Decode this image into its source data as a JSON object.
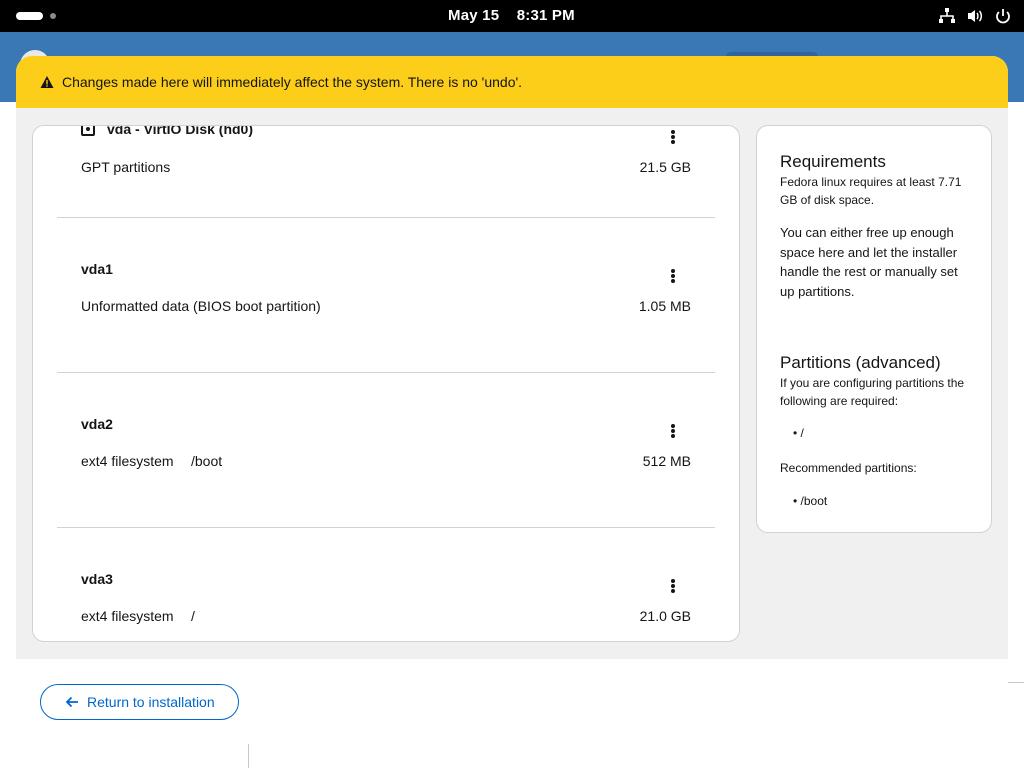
{
  "topbar": {
    "date": "May 15",
    "time": "8:31 PM",
    "icons": [
      "network-icon",
      "volume-icon",
      "power-icon"
    ]
  },
  "warning": {
    "text": "Changes made here will immediately affect the system. There is no 'undo'.",
    "icon": "warning-icon",
    "color": "#fcce1a"
  },
  "disk": {
    "title": "vda -  VirtIO Disk (hd0)",
    "type": "GPT partitions",
    "size": "21.5 GB",
    "partitions": [
      {
        "name": "vda1",
        "type": "Unformatted data (BIOS boot partition)",
        "mount": "",
        "size": "1.05 MB"
      },
      {
        "name": "vda2",
        "type": "ext4 filesystem",
        "mount": "/boot",
        "size": "512 MB"
      },
      {
        "name": "vda3",
        "type": "ext4 filesystem",
        "mount": "/",
        "size": "21.0 GB"
      }
    ]
  },
  "sidebar": {
    "requirements_title": "Requirements",
    "requirements_text": "Fedora linux requires at least 7.71 GB of disk space.",
    "requirements_hint": "You can either free up enough space here and let the installer handle the rest or manually set up partitions.",
    "advanced_title": "Partitions (advanced)",
    "advanced_text": "If you are configuring partitions the following are required:",
    "required": [
      "/"
    ],
    "recommended_label": "Recommended partitions:",
    "recommended": [
      "/boot"
    ]
  },
  "footer": {
    "back_label": "Return to installation",
    "accent": "#0066cc"
  }
}
